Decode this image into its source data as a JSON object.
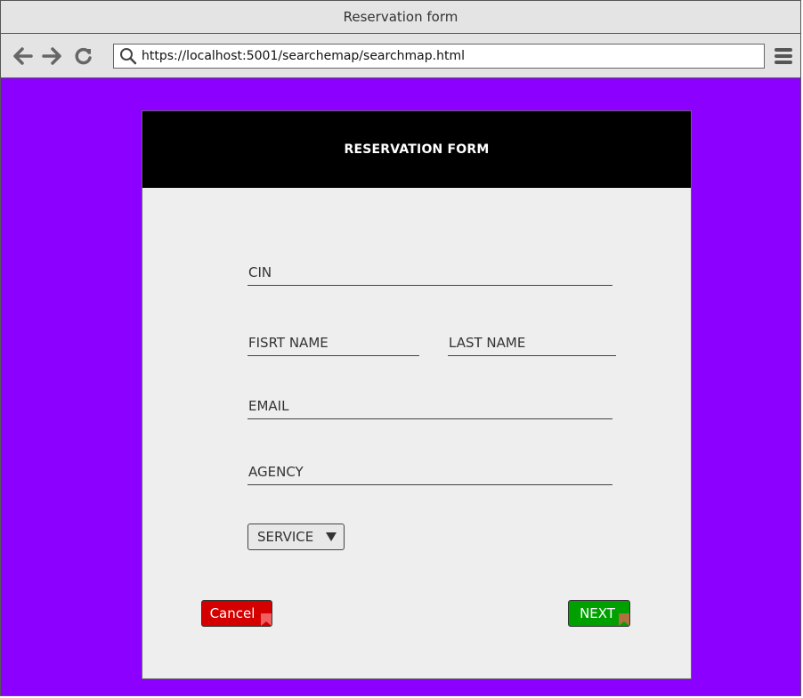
{
  "window": {
    "title": "Reservation form"
  },
  "browser": {
    "url": "https://localhost:5001/searchemap/searchmap.html",
    "icons": {
      "back": "arrow-left-icon",
      "forward": "arrow-right-icon",
      "reload": "reload-icon",
      "search": "search-icon",
      "menu": "hamburger-menu-icon"
    }
  },
  "form": {
    "header": "RESERVATION FORM",
    "fields": {
      "cin": "CIN",
      "first_name": "FISRT NAME",
      "last_name": "LAST NAME",
      "email": "EMAIL",
      "agency": "AGENCY"
    },
    "service_select": {
      "value": "SERVICE"
    },
    "buttons": {
      "cancel": "Cancel",
      "next": "NEXT"
    }
  },
  "colors": {
    "page_background": "#8c00ff",
    "header_background": "#000000",
    "panel_background": "#eeeeee",
    "cancel_button": "#d40000",
    "next_button": "#00a000"
  }
}
